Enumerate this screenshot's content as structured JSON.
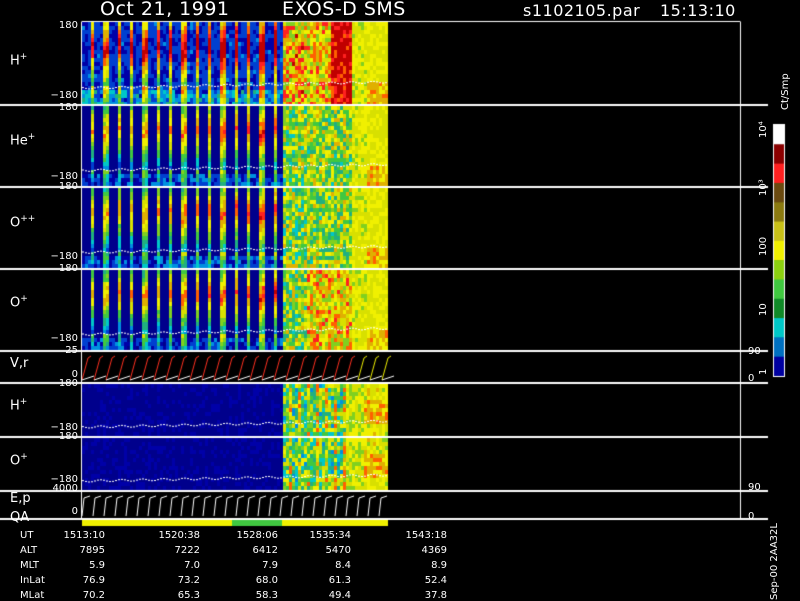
{
  "header": {
    "date": "Oct 21, 1991",
    "instrument": "EXOS-D SMS",
    "file": "s1102105.par",
    "time": "15:13:10"
  },
  "panels": [
    {
      "label": "H",
      "sup": "+",
      "top_tick": "180",
      "bottom_tick": "−180"
    },
    {
      "label": "He",
      "sup": "+",
      "top_tick": "180",
      "bottom_tick": "−180"
    },
    {
      "label": "O",
      "sup": "++",
      "top_tick": "180",
      "bottom_tick": "−180"
    },
    {
      "label": "O",
      "sup": "+",
      "top_tick": "180",
      "bottom_tick": "−180"
    },
    {
      "label": "V,r",
      "sup": "",
      "top_tick": "25",
      "bottom_tick": "0",
      "right_top": "90",
      "right_bottom": "0"
    },
    {
      "label": "H",
      "sup": "+",
      "top_tick": "180",
      "bottom_tick": "−180"
    },
    {
      "label": "O",
      "sup": "+",
      "top_tick": "180",
      "bottom_tick": "−180",
      "right_top": "90"
    },
    {
      "label": "E,p",
      "sup": "",
      "top_tick": "4000",
      "bottom_tick": "0",
      "right_bottom": "0"
    }
  ],
  "qa_label": "QA",
  "colorbar": {
    "title": "Ct/Smp",
    "ticks": [
      "10⁴",
      "10³",
      "100",
      "10",
      "1"
    ],
    "colors": [
      "#ffffff",
      "#8b0000",
      "#ff2020",
      "#6b4a10",
      "#8b7a10",
      "#c8c018",
      "#f0f000",
      "#8cd010",
      "#40c840",
      "#108a28",
      "#00c8c8",
      "#0070c0",
      "#0000a0"
    ]
  },
  "footer": {
    "rows": [
      {
        "label": "UT",
        "values": [
          "1513:10",
          "1520:38",
          "1528:06",
          "1535:34",
          "1543:18"
        ]
      },
      {
        "label": "ALT",
        "values": [
          "7895",
          "7222",
          "6412",
          "5470",
          "4369"
        ]
      },
      {
        "label": "MLT",
        "values": [
          "5.9",
          "7.0",
          "7.9",
          "8.4",
          "8.9"
        ]
      },
      {
        "label": "InLat",
        "values": [
          "76.9",
          "73.2",
          "68.0",
          "61.3",
          "52.4"
        ]
      },
      {
        "label": "MLat",
        "values": [
          "70.2",
          "65.3",
          "58.3",
          "49.4",
          "37.8"
        ]
      }
    ],
    "version": "Sep-00 2AA32L"
  },
  "chart_data": {
    "type": "heatmap",
    "title": "Oct 21, 1991   EXOS-D SMS",
    "xlabel": "UT",
    "x_ticks": [
      "1513:10",
      "1520:38",
      "1528:06",
      "1535:34",
      "1543:18"
    ],
    "y_range": [
      -180,
      180
    ],
    "color_scale": "log",
    "color_range": [
      1,
      10000
    ],
    "color_label": "Ct/Smp",
    "series": [
      {
        "name": "H+"
      },
      {
        "name": "He+"
      },
      {
        "name": "O++"
      },
      {
        "name": "O+"
      },
      {
        "name": "V,r"
      },
      {
        "name": "H+"
      },
      {
        "name": "O+"
      },
      {
        "name": "E,p"
      }
    ]
  }
}
